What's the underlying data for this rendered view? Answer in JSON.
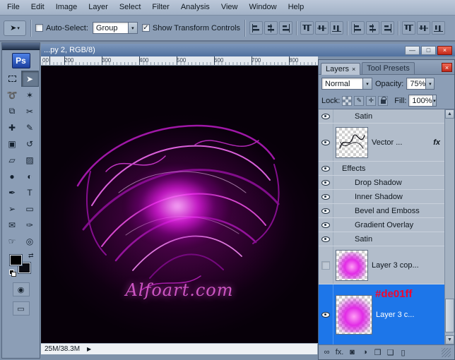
{
  "icons": {
    "dropdown": "▾",
    "up_arrow": "▲",
    "down_arrow": "▼",
    "right_arrow": "▶",
    "close": "×",
    "minimize": "—",
    "maximize": "□",
    "swap": "⇄",
    "check": "✓",
    "brush": "✎",
    "move_cross": "✛",
    "quick_mask": "◉",
    "screen_mode": "▭",
    "move_tool": "➤"
  },
  "menubar": {
    "items": [
      "File",
      "Edit",
      "Image",
      "Layer",
      "Select",
      "Filter",
      "Analysis",
      "View",
      "Window",
      "Help"
    ]
  },
  "options_bar": {
    "auto_select_label": "Auto-Select:",
    "auto_select_checked": false,
    "group_dropdown_value": "Group",
    "show_transform_label": "Show Transform Controls",
    "show_transform_checked": true,
    "align_buttons": [
      "align-top-edges-button",
      "align-vertical-centers-button",
      "align-bottom-edges-button",
      "align-left-edges-button",
      "align-horizontal-centers-button",
      "align-right-edges-button",
      "distribute-top-edges-button",
      "distribute-vertical-centers-button",
      "distribute-bottom-edges-button",
      "distribute-left-edges-button",
      "distribute-horizontal-centers-button",
      "distribute-right-edges-button"
    ]
  },
  "toolbox": {
    "logo": "Ps",
    "tools": [
      {
        "name": "rectangular-marquee-tool",
        "glyph": null,
        "selected": false
      },
      {
        "name": "move-tool",
        "glyph": "➤",
        "selected": true
      },
      {
        "name": "lasso-tool",
        "glyph": "➰",
        "selected": false
      },
      {
        "name": "magic-wand-tool",
        "glyph": "✶",
        "selected": false
      },
      {
        "name": "crop-tool",
        "glyph": "⧉",
        "selected": false
      },
      {
        "name": "slice-tool",
        "glyph": "✂",
        "selected": false
      },
      {
        "name": "healing-brush-tool",
        "glyph": "✚",
        "selected": false
      },
      {
        "name": "brush-tool",
        "glyph": "✎",
        "selected": false
      },
      {
        "name": "clone-stamp-tool",
        "glyph": "▣",
        "selected": false
      },
      {
        "name": "history-brush-tool",
        "glyph": "↺",
        "selected": false
      },
      {
        "name": "eraser-tool",
        "glyph": "▱",
        "selected": false
      },
      {
        "name": "gradient-tool",
        "glyph": "▨",
        "selected": false
      },
      {
        "name": "blur-tool",
        "glyph": "●",
        "selected": false
      },
      {
        "name": "dodge-tool",
        "glyph": "◐",
        "selected": false
      },
      {
        "name": "pen-tool",
        "glyph": "✒",
        "selected": false
      },
      {
        "name": "type-tool",
        "glyph": "T",
        "selected": false
      },
      {
        "name": "path-selection-tool",
        "glyph": "➢",
        "selected": false
      },
      {
        "name": "shape-tool",
        "glyph": "▭",
        "selected": false
      },
      {
        "name": "notes-tool",
        "glyph": "✉",
        "selected": false
      },
      {
        "name": "eyedropper-tool",
        "glyph": "✑",
        "selected": false
      },
      {
        "name": "hand-tool",
        "glyph": "☞",
        "selected": false
      },
      {
        "name": "zoom-tool",
        "glyph": "◎",
        "selected": false
      }
    ]
  },
  "document": {
    "title": "...py 2, RGB/8)",
    "ruler_numbers": [
      "00",
      "200",
      "300",
      "400",
      "500",
      "600",
      "700",
      "800"
    ],
    "status": "25M/38.3M",
    "watermark": "Alfoart.com"
  },
  "layers_panel": {
    "tabs": [
      {
        "label": "Layers",
        "active": true
      },
      {
        "label": "Tool Presets",
        "active": false
      }
    ],
    "blend_mode": "Normal",
    "opacity_label": "Opacity:",
    "opacity_value": "75%",
    "lock_label": "Lock:",
    "fill_label": "Fill:",
    "fill_value": "100%",
    "hex_annotation_color": "#f2062e",
    "rows": [
      {
        "type": "effect",
        "name": "effect-row-satin-upper",
        "label": "Satin",
        "eye": true
      },
      {
        "type": "layer",
        "name": "layer-row-vector",
        "label": "Vector ...",
        "eye": true,
        "thumb": "scribble",
        "fx": "fx"
      },
      {
        "type": "effects-header",
        "name": "effects-header-row",
        "label": "Effects",
        "eye": true
      },
      {
        "type": "effect",
        "name": "effect-row-drop-shadow",
        "label": "Drop Shadow",
        "eye": true
      },
      {
        "type": "effect",
        "name": "effect-row-inner-shadow",
        "label": "Inner Shadow",
        "eye": true
      },
      {
        "type": "effect",
        "name": "effect-row-bevel-and-emboss",
        "label": "Bevel and Emboss",
        "eye": true
      },
      {
        "type": "effect",
        "name": "effect-row-gradient-overlay",
        "label": "Gradient Overlay",
        "eye": true
      },
      {
        "type": "effect",
        "name": "effect-row-satin",
        "label": "Satin",
        "eye": true
      },
      {
        "type": "layer",
        "name": "layer-row-layer3-copy",
        "label": "Layer 3 cop...",
        "eye": false,
        "thumb": "blob"
      },
      {
        "type": "layer",
        "name": "layer-row-layer3",
        "label": "Layer 3 c...",
        "eye": true,
        "thumb": "blob",
        "selected": true,
        "annotation": "#de01ff"
      }
    ],
    "bottom_icons": [
      {
        "name": "link-layers-button",
        "glyph": "∞"
      },
      {
        "name": "add-layer-style-button",
        "glyph": "fx."
      },
      {
        "name": "add-layer-mask-button",
        "glyph": "◙"
      },
      {
        "name": "new-adjustment-layer-button",
        "glyph": "◑"
      },
      {
        "name": "new-group-button",
        "glyph": "❒"
      },
      {
        "name": "new-layer-button",
        "glyph": "❏"
      },
      {
        "name": "delete-layer-button",
        "glyph": "▯"
      }
    ]
  }
}
